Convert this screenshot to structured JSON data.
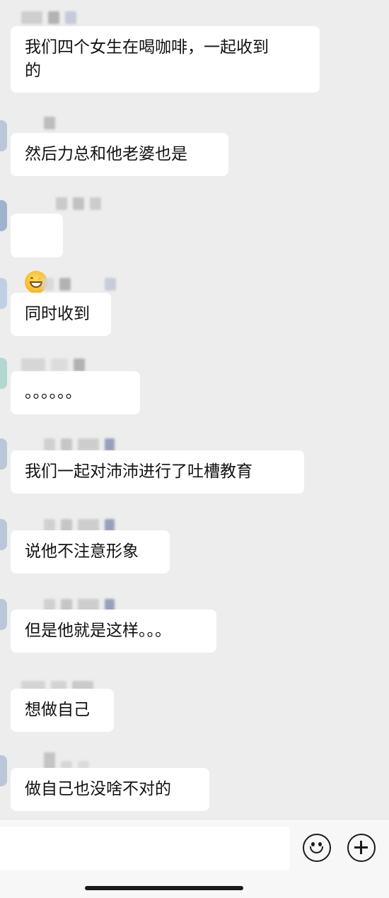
{
  "messages": [
    {
      "text": "我们四个女生在喝咖啡，一起收到\n的"
    },
    {
      "text": "然后力总和他老婆也是"
    },
    {
      "text": "",
      "emoji": "grinning-face-emoji"
    },
    {
      "text": "同时收到"
    },
    {
      "text": "。。。。。。"
    },
    {
      "text": "我们一起对沛沛进行了吐槽教育"
    },
    {
      "text": "说他不注意形象"
    },
    {
      "text": "但是他就是这样。。。"
    },
    {
      "text": "想做自己"
    },
    {
      "text": "做自己也没啥不对的"
    }
  ],
  "input_bar": {
    "input_value": "",
    "icons": [
      "emoji-icon",
      "plus-icon"
    ]
  },
  "colors": {
    "background": "#ededed",
    "bubble": "#ffffff",
    "text": "#111111"
  }
}
